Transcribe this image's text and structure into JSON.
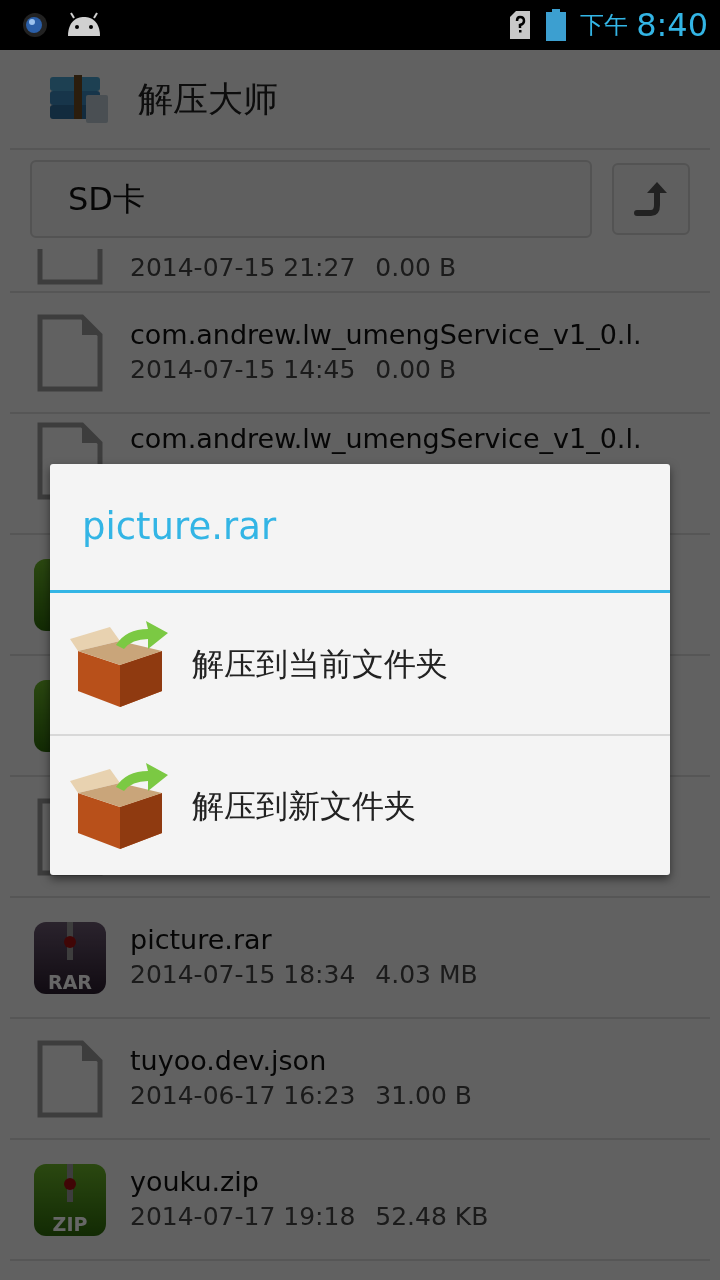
{
  "status_bar": {
    "period": "下午",
    "time": "8:40"
  },
  "app_bar": {
    "title": "解压大师"
  },
  "path_bar": {
    "path": "SD卡"
  },
  "files": [
    {
      "kind": "file",
      "date": "2014-07-15 21:27",
      "size": "0.00 B"
    },
    {
      "kind": "file",
      "name": "com.andrew.lw_umengService_v1_0.l.",
      "date": "2014-07-15 14:45",
      "size": "0.00 B"
    },
    {
      "kind": "file",
      "name": "com.andrew.lw_umengService_v1_0.l."
    },
    {
      "kind": "zip"
    },
    {
      "kind": "zip"
    },
    {
      "kind": "file"
    },
    {
      "kind": "rar",
      "icon_label": "RAR",
      "name": "picture.rar",
      "date": "2014-07-15 18:34",
      "size": "4.03 MB"
    },
    {
      "kind": "file",
      "name": "tuyoo.dev.json",
      "date": "2014-06-17 16:23",
      "size": "31.00 B"
    },
    {
      "kind": "zip",
      "icon_label": "ZIP",
      "name": "youku.zip",
      "date": "2014-07-17 19:18",
      "size": "52.48 KB"
    }
  ],
  "dialog": {
    "title": "picture.rar",
    "options": [
      {
        "label": "解压到当前文件夹"
      },
      {
        "label": "解压到新文件夹"
      }
    ]
  }
}
